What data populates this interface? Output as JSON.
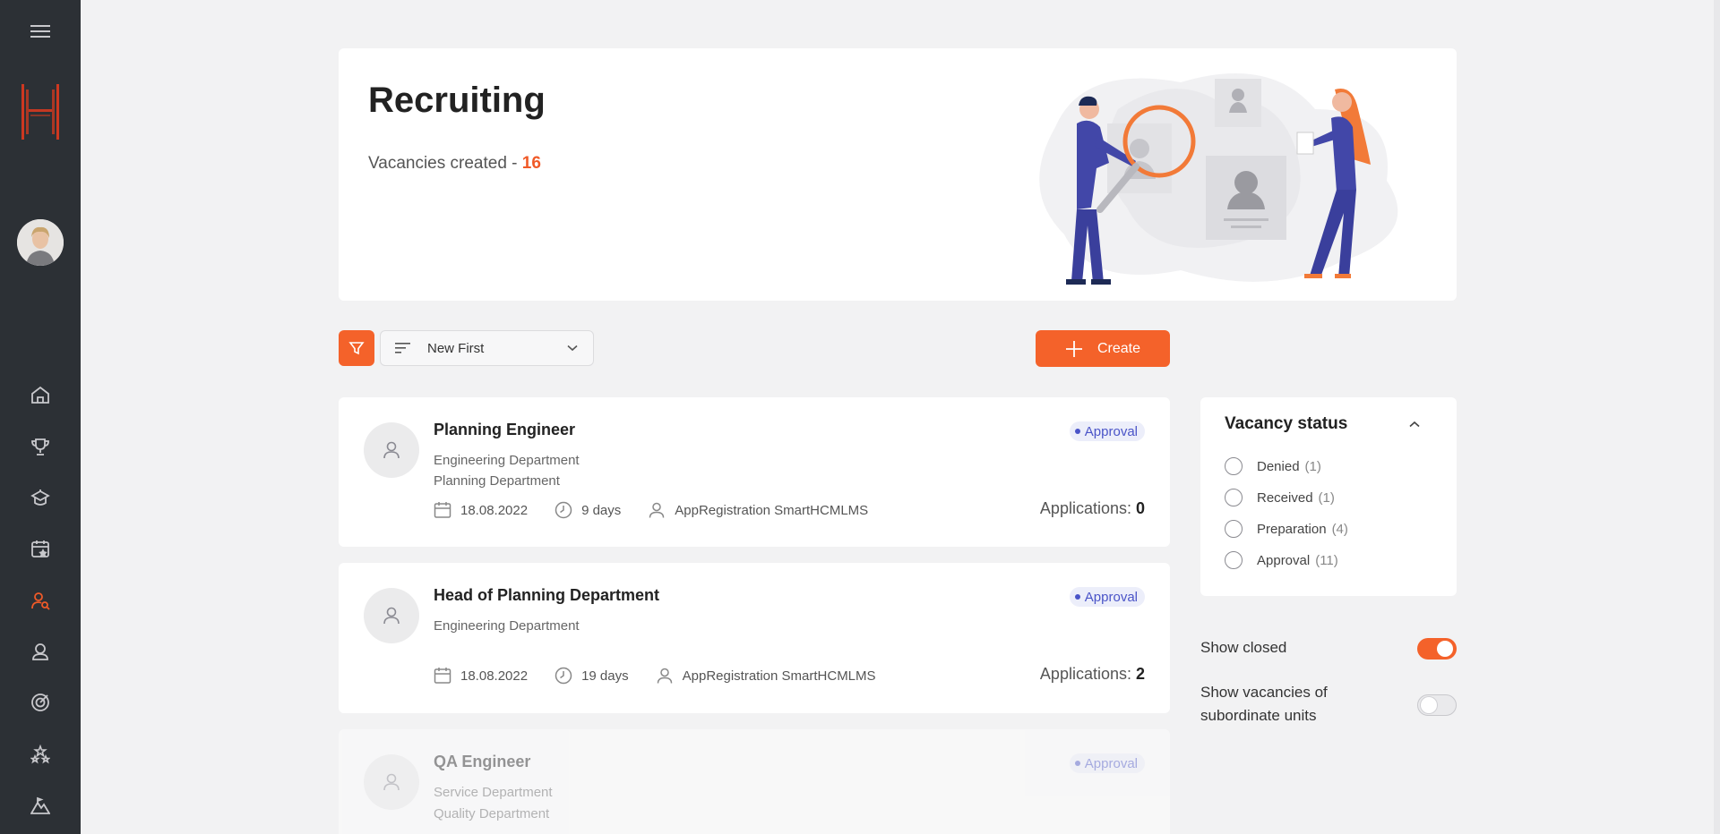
{
  "page": {
    "title": "Recruiting",
    "vacancies_created_label": "Vacancies created - ",
    "vacancies_created_count": "16"
  },
  "toolbar": {
    "sort_label": "New First",
    "create_label": "Create"
  },
  "vacancies": [
    {
      "title": "Planning Engineer",
      "dept1": "Engineering Department",
      "dept2": "Planning Department",
      "status": "Approval",
      "date": "18.08.2022",
      "duration": "9 days",
      "author": "AppRegistration SmartHCMLMS",
      "applications_label": "Applications: ",
      "applications": "0"
    },
    {
      "title": "Head of Planning Department",
      "dept1": "Engineering Department",
      "status": "Approval",
      "date": "18.08.2022",
      "duration": "19 days",
      "author": "AppRegistration SmartHCMLMS",
      "applications_label": "Applications: ",
      "applications": "2"
    },
    {
      "title": "QA Engineer",
      "dept1": "Service Department",
      "dept2": "Quality Department",
      "status": "Approval"
    }
  ],
  "status_filter": {
    "title": "Vacancy status",
    "items": [
      {
        "label": "Denied",
        "count": "(1)"
      },
      {
        "label": "Received",
        "count": "(1)"
      },
      {
        "label": "Preparation",
        "count": "(4)"
      },
      {
        "label": "Approval",
        "count": "(11)"
      }
    ]
  },
  "toggles": {
    "show_closed": "Show closed",
    "show_subordinate_line1": "Show vacancies of",
    "show_subordinate_line2": "subordinate units"
  },
  "icons": {
    "menu": "menu-icon",
    "home": "home-icon",
    "trophy": "trophy-icon",
    "education": "education-icon",
    "calendar": "calendar-star-icon",
    "recruiting": "user-search-icon",
    "profile": "user-icon",
    "goals": "target-icon",
    "competencies": "stars-icon",
    "career": "mountain-icon"
  },
  "colors": {
    "accent": "#f4622a",
    "sidebar": "#2c3035",
    "badge_text": "#4a54c8",
    "badge_bg": "#eceefa"
  }
}
